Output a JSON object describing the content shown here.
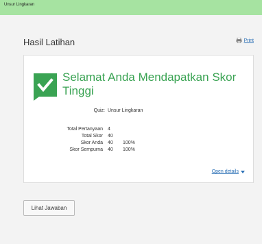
{
  "topbar": {
    "title": "Unsur Lingkaran"
  },
  "panel": {
    "title": "Hasil Latihan",
    "print_label": "Print"
  },
  "result": {
    "headline": "Selamat Anda Mendapatkan Skor Tinggi",
    "quiz_label": "Quiz:",
    "quiz_value": "Unsur Lingkaran",
    "stats": [
      {
        "label": "Total Pertanyaan",
        "value": "4",
        "percent": ""
      },
      {
        "label": "Total Skor",
        "value": "40",
        "percent": ""
      },
      {
        "label": "Skor Anda",
        "value": "40",
        "percent": "100%"
      },
      {
        "label": "Skor Sempurna",
        "value": "40",
        "percent": "100%"
      }
    ],
    "open_details_label": "Open details"
  },
  "actions": {
    "view_answers_label": "Lihat Jawaban"
  },
  "colors": {
    "topbar": "#a6e3a1",
    "success": "#3aa353",
    "link": "#2a6fb5"
  },
  "icons": {
    "print": "printer-icon",
    "check": "checkmark-badge-icon",
    "caret": "caret-down-icon"
  }
}
